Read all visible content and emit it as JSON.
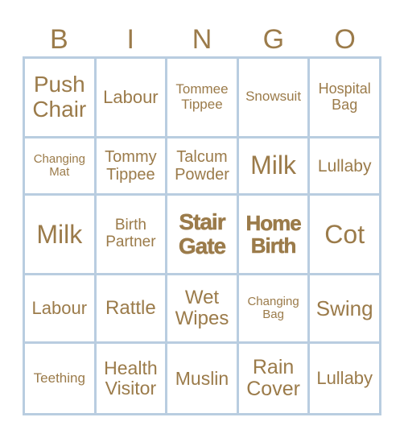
{
  "header": [
    "B",
    "I",
    "N",
    "G",
    "O"
  ],
  "cells": [
    [
      "Push Chair",
      "Labour",
      "Tommee Tippee",
      "Snowsuit",
      "Hospital Bag"
    ],
    [
      "Changing Mat",
      "Tommy Tippee",
      "Talcum Powder",
      "Milk",
      "Lullaby"
    ],
    [
      "Milk",
      "Birth Partner",
      "Stair Gate",
      "Home Birth",
      "Cot"
    ],
    [
      "Labour",
      "Rattle",
      "Wet Wipes",
      "Changing Bag",
      "Swing"
    ],
    [
      "Teething",
      "Health Visitor",
      "Muslin",
      "Rain Cover",
      "Lullaby"
    ]
  ],
  "colors": {
    "text": "#9b7b4a",
    "border": "#b9cde0"
  }
}
